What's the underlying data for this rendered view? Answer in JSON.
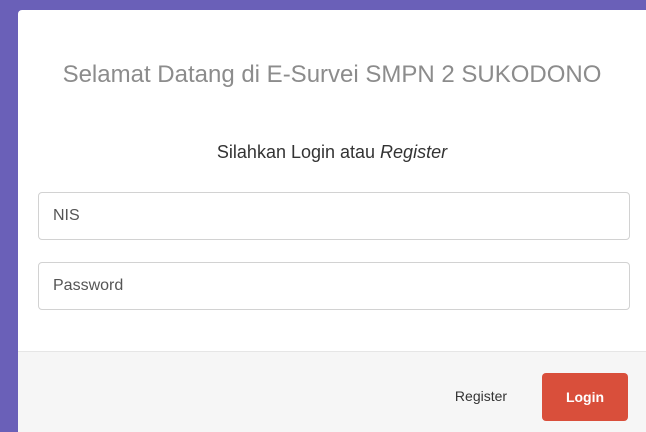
{
  "login": {
    "title": "Selamat Datang di E-Survei SMPN 2 SUKODONO",
    "subtitle_prefix": "Silahkan Login atau ",
    "subtitle_emphasis": "Register",
    "nis_placeholder": "NIS",
    "password_placeholder": "Password",
    "register_label": "Register",
    "login_label": "Login"
  },
  "colors": {
    "accent": "#d94f3b",
    "backdrop": "#6a60b8",
    "title_text": "#8c8c8c",
    "footer_bg": "#f6f6f6"
  }
}
